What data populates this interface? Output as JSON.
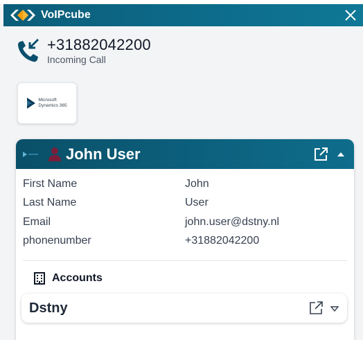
{
  "app": {
    "title": "VoIPcube",
    "colors": {
      "titlebar": "#0d6b8a",
      "logo_orange": "#f59e0b",
      "logo_blue": "#0b5d79"
    }
  },
  "call": {
    "number": "+31882042200",
    "status": "Incoming Call",
    "icon": "incoming-call-icon"
  },
  "crm": {
    "name_line1": "Microsoft",
    "name_line2": "Dynamics 365"
  },
  "contact": {
    "name": "John User",
    "fields": [
      {
        "label": "First Name",
        "value": "John"
      },
      {
        "label": "Last Name",
        "value": "User"
      },
      {
        "label": "Email",
        "value": "john.user@dstny.nl"
      },
      {
        "label": "phonenumber",
        "value": "+31882042200"
      }
    ],
    "icons": {
      "person": "person-icon",
      "open": "external-link-icon",
      "collapse": "chevron-up-icon"
    }
  },
  "accounts": {
    "title": "Accounts",
    "icon": "building-icon",
    "items": [
      {
        "name": "Dstny"
      }
    ]
  }
}
